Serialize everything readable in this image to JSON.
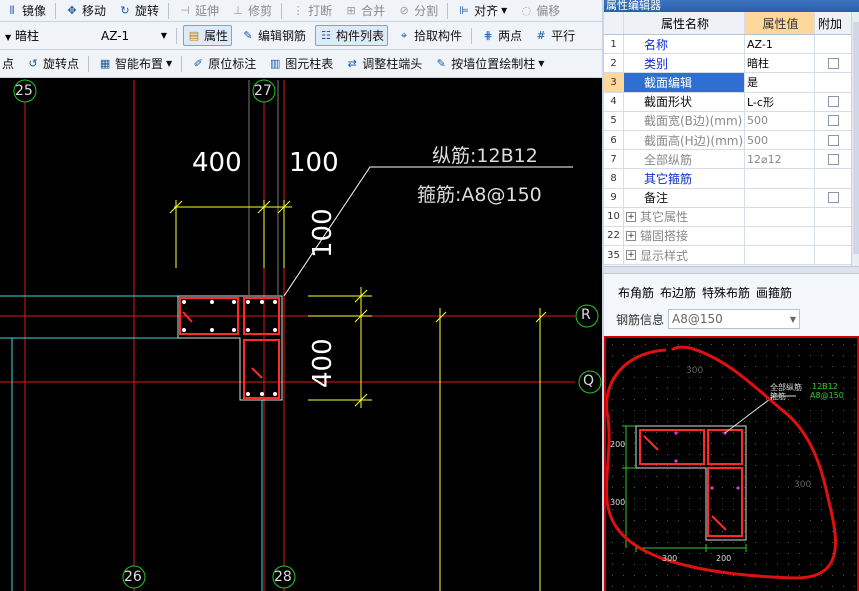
{
  "toolbar1": {
    "mirror": "镜像",
    "move": "移动",
    "rotate": "旋转",
    "extend": "延伸",
    "trim": "修剪",
    "break": "打断",
    "merge": "合并",
    "split": "分割",
    "align": "对齐",
    "offset": "偏移"
  },
  "toolbar2": {
    "type_value": "暗柱",
    "name_value": "AZ-1",
    "properties": "属性",
    "edit_rebar": "编辑钢筋",
    "component_list": "构件列表",
    "pick_component": "拾取构件",
    "two_points": "两点",
    "parallel": "平行"
  },
  "toolbar3": {
    "point": "点",
    "rotate_point": "旋转点",
    "smart_layout": "智能布置",
    "origin_annotation": "原位标注",
    "element_table": "图元柱表",
    "adjust_column_end": "调整柱端头",
    "draw_by_wall": "按墙位置绘制柱"
  },
  "canvas": {
    "axis_labels": [
      "25",
      "27",
      "26",
      "28",
      "R",
      "Q"
    ],
    "dims": {
      "d400_top": "400",
      "d100_top": "100",
      "d100_side": "100",
      "d400_side": "400"
    },
    "longitudinal": "纵筋:12B12",
    "stirrup": "箍筋:A8@150"
  },
  "panel": {
    "title": "属性编辑器",
    "headers": {
      "name": "属性名称",
      "value": "属性值",
      "add": "附加"
    },
    "rows": [
      {
        "no": "1",
        "name": "名称",
        "value": "AZ-1",
        "style": "blue",
        "checkbox": false,
        "expand": false
      },
      {
        "no": "2",
        "name": "类别",
        "value": "暗柱",
        "style": "blue",
        "checkbox": true,
        "expand": false
      },
      {
        "no": "3",
        "name": "截面编辑",
        "value": "是",
        "style": "blue",
        "checkbox": false,
        "expand": false,
        "selected": true
      },
      {
        "no": "4",
        "name": "截面形状",
        "value": "L-c形",
        "style": "dark",
        "checkbox": true,
        "expand": false
      },
      {
        "no": "5",
        "name": "截面宽(B边)(mm)",
        "value": "500",
        "style": "gray",
        "checkbox": true,
        "expand": false
      },
      {
        "no": "6",
        "name": "截面高(H边)(mm)",
        "value": "500",
        "style": "gray",
        "checkbox": true,
        "expand": false
      },
      {
        "no": "7",
        "name": "全部纵筋",
        "value": "12⌀12",
        "style": "gray",
        "checkbox": true,
        "expand": false
      },
      {
        "no": "8",
        "name": "其它箍筋",
        "value": "",
        "style": "blue",
        "checkbox": false,
        "expand": false
      },
      {
        "no": "9",
        "name": "备注",
        "value": "",
        "style": "dark",
        "checkbox": true,
        "expand": false
      },
      {
        "no": "10",
        "name": "其它属性",
        "value": "",
        "style": "gray",
        "checkbox": false,
        "expand": true
      },
      {
        "no": "22",
        "name": "锚固搭接",
        "value": "",
        "style": "gray",
        "checkbox": false,
        "expand": true
      },
      {
        "no": "35",
        "name": "显示样式",
        "value": "",
        "style": "gray",
        "checkbox": false,
        "expand": true
      }
    ],
    "rebar_tabs": [
      "布角筋",
      "布边筋",
      "特殊布筋",
      "画箍筋"
    ],
    "rebar_info_label": "钢筋信息",
    "rebar_info_value": "A8@150",
    "preview": {
      "legend_line1": "全部纵筋",
      "legend_line2": "箍筋",
      "legend_val1": "12B12",
      "legend_val2": "A8@150",
      "dim_300_top": "300",
      "dim_200": "200",
      "dim_300_left": "300",
      "dim_300_bottom": "300",
      "dim_200_bottom": "200",
      "dim_300_right": "300"
    }
  },
  "colors": {
    "selection": "#2f6fd1",
    "header_value_bg": "#ffd79a",
    "axis_green": "#28c428",
    "dim_yellow": "#ffff33",
    "wall_cyan": "#33dddd",
    "annotation_red": "#dd1111"
  }
}
